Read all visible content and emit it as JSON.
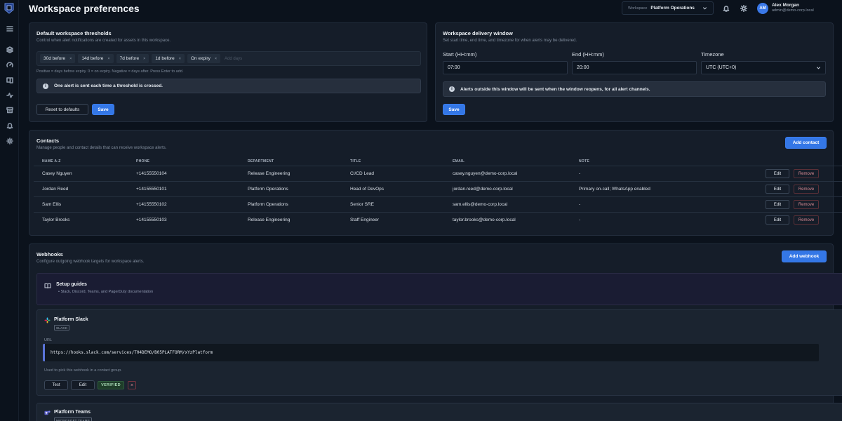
{
  "header": {
    "title": "Workspace preferences",
    "workspace_label": "Workspace",
    "workspace_value": "Platform Operations",
    "user_initials": "AM",
    "user_name": "Alex Morgan",
    "user_email": "admin@demo-corp.local"
  },
  "sidebar": {
    "icons": [
      "menu-icon",
      "layers-icon",
      "gauge-icon",
      "book-icon",
      "activity-icon",
      "archive-icon",
      "bell-icon",
      "settings-icon"
    ]
  },
  "thresholds": {
    "title": "Default workspace thresholds",
    "subtitle": "Control when alert notifications are created for assets in this workspace.",
    "chips": [
      "30d before",
      "14d before",
      "7d before",
      "1d before",
      "On expiry"
    ],
    "chip_remove": "×",
    "input_placeholder": "Add days",
    "hint": "Positive = days before expiry. 0 = on expiry. Negative = days after. Press Enter to add.",
    "info": "One alert is sent each time a threshold is crossed.",
    "reset_label": "Reset to defaults",
    "save_label": "Save"
  },
  "delivery": {
    "title": "Workspace delivery window",
    "subtitle": "Set start time, end time, and timezone for when alerts may be delivered.",
    "start_label": "Start (HH:mm)",
    "start_value": "07:00",
    "end_label": "End (HH:mm)",
    "end_value": "20:00",
    "tz_label": "Timezone",
    "tz_value": "UTC (UTC+0)",
    "info": "Alerts outside this window will be sent when the window reopens, for all alert channels.",
    "save_label": "Save"
  },
  "contacts": {
    "title": "Contacts",
    "subtitle": "Manage people and contact details that can receive workspace alerts.",
    "add_label": "Add contact",
    "columns": [
      "NAME A-Z",
      "PHONE",
      "DEPARTMENT",
      "TITLE",
      "EMAIL",
      "NOTE"
    ],
    "edit_label": "Edit",
    "remove_label": "Remove",
    "rows": [
      {
        "name": "Casey Nguyen",
        "phone": "+14155550104",
        "department": "Release Engineering",
        "title": "CI/CD Lead",
        "email": "casey.nguyen@demo-corp.local",
        "note": "-"
      },
      {
        "name": "Jordan Reed",
        "phone": "+14155550101",
        "department": "Platform Operations",
        "title": "Head of DevOps",
        "email": "jordan.reed@demo-corp.local",
        "note": "Primary on-call; WhatsApp enabled"
      },
      {
        "name": "Sam Ellis",
        "phone": "+14155550102",
        "department": "Platform Operations",
        "title": "Senior SRE",
        "email": "sam.ellis@demo-corp.local",
        "note": "-"
      },
      {
        "name": "Taylor Brooks",
        "phone": "+14155550103",
        "department": "Release Engineering",
        "title": "Staff Engineer",
        "email": "taylor.brooks@demo-corp.local",
        "note": "-"
      }
    ]
  },
  "webhooks": {
    "title": "Webhooks",
    "subtitle": "Configure outgoing webhook targets for workspace alerts.",
    "add_label": "Add webhook",
    "guides_title": "Setup guides",
    "guides_sub": "Slack, Discord, Teams, and PagerDuty documentation",
    "items": [
      {
        "name": "Platform Slack",
        "type": "SLACK",
        "url_label": "URL",
        "url": "https://hooks.slack.com/services/T04DEMO/B05PLATFORM/xYzPlatform",
        "note": "Used to pick this webhook in a contact group.",
        "test_label": "Test",
        "edit_label": "Edit",
        "status": "VERIFIED",
        "remove_glyph": "×"
      },
      {
        "name": "Platform Teams",
        "type": "MICROSOFT TEAMS"
      }
    ]
  },
  "colors": {
    "accent": "#3477e6",
    "background": "#0b121c",
    "card": "#151d29",
    "danger": "#d98a93",
    "success": "#a9d8b6"
  }
}
